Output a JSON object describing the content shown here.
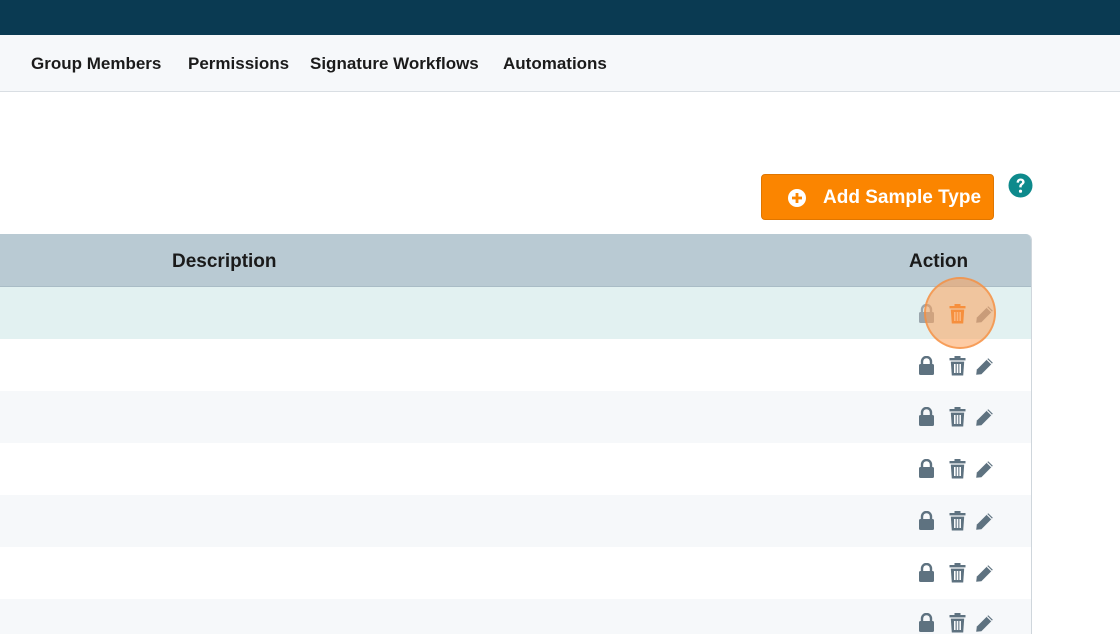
{
  "tabs": [
    {
      "label": "Group Members"
    },
    {
      "label": "Permissions"
    },
    {
      "label": "Signature Workflows"
    },
    {
      "label": "Automations"
    }
  ],
  "toolbar": {
    "add_label": "Add Sample Type"
  },
  "table": {
    "columns": [
      {
        "label": "Description"
      },
      {
        "label": "Action"
      }
    ],
    "rows": [
      {
        "icons": [
          "lock-icon",
          "trash-icon",
          "pencil-icon"
        ],
        "state": "hovered-delete"
      },
      {
        "icons": [
          "lock-icon",
          "trash-icon",
          "pencil-icon"
        ]
      },
      {
        "icons": [
          "lock-icon",
          "trash-icon",
          "pencil-icon"
        ]
      },
      {
        "icons": [
          "lock-icon",
          "trash-icon",
          "pencil-icon"
        ]
      },
      {
        "icons": [
          "lock-icon",
          "trash-icon",
          "pencil-icon"
        ]
      },
      {
        "icons": [
          "lock-icon",
          "trash-icon",
          "pencil-icon"
        ]
      },
      {
        "icons": [
          "lock-icon",
          "trash-icon",
          "pencil-icon"
        ]
      }
    ]
  },
  "colors": {
    "header_bar": "#0a3a52",
    "accent_orange": "#fb8500",
    "help_teal": "#0e8a8c",
    "icon_gray": "#5e7280",
    "table_header": "#b9cad3",
    "row_highlight": "#e2f1f1"
  }
}
